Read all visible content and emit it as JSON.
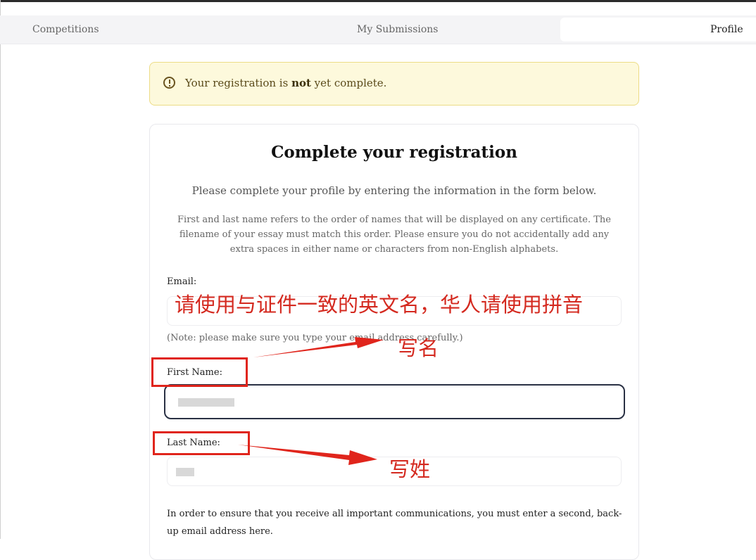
{
  "nav": {
    "tabs": [
      {
        "label": "Competitions",
        "active": false
      },
      {
        "label": "My Submissions",
        "active": false
      },
      {
        "label": "Profile",
        "active": true
      }
    ]
  },
  "alert": {
    "icon": "alert-circle-icon",
    "text_before": "Your registration is ",
    "text_bold": "not",
    "text_after": " yet complete."
  },
  "form": {
    "title": "Complete your registration",
    "subtitle": "Please complete your profile by entering the information in the form below.",
    "note": "First and last name refers to the order of names that will be displayed on any certificate. The filename of your essay must match this order. Please ensure you do not accidentally add any extra spaces in either name or characters from non-English alphabets.",
    "email_label": "Email:",
    "email_note": "(Note: please make sure you type your email address carefully.)",
    "first_name_label": "First Name:",
    "last_name_label": "Last Name:",
    "backup_text": "In order to ensure that you receive all important communications, you must enter a second, back-up email address here."
  },
  "annotations": {
    "line1": "请使用与证件一致的英文名，华人请使用拼音",
    "line2": "写名",
    "last_name_hint": "写姓",
    "color": "#e0251c"
  }
}
